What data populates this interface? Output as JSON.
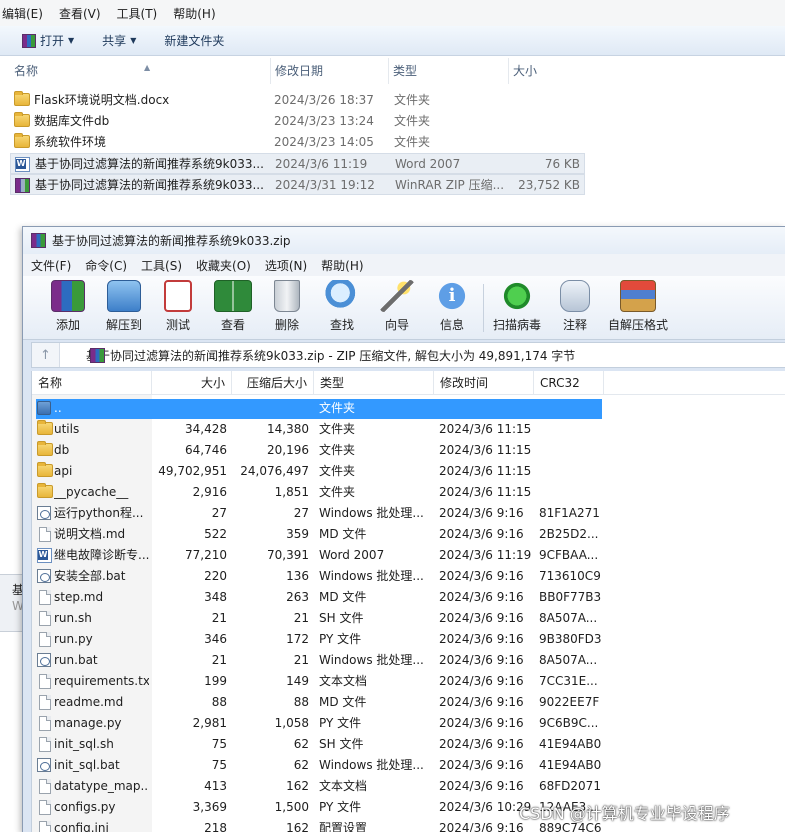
{
  "explorer": {
    "menu": [
      "编辑(E)",
      "查看(V)",
      "工具(T)",
      "帮助(H)"
    ],
    "toolbar": {
      "open_label": "打开",
      "share_label": "共享",
      "new_folder_label": "新建文件夹"
    },
    "columns": {
      "name": "名称",
      "date": "修改日期",
      "type": "类型",
      "size": "大小"
    },
    "files": [
      {
        "name": "Flask环境说明文档.docx",
        "date": "2024/3/26 18:37",
        "type": "文件夹",
        "size": "",
        "icon": "folder-icon"
      },
      {
        "name": "数据库文件db",
        "date": "2024/3/23 13:24",
        "type": "文件夹",
        "size": "",
        "icon": "folder-icon"
      },
      {
        "name": "系统软件环境",
        "date": "2024/3/23 14:05",
        "type": "文件夹",
        "size": "",
        "icon": "folder-icon"
      },
      {
        "name": "基于协同过滤算法的新闻推荐系统9k033...",
        "date": "2024/3/6 11:19",
        "type": "Word 2007",
        "size": "76 KB",
        "icon": "word-icon"
      },
      {
        "name": "基于协同过滤算法的新闻推荐系统9k033...",
        "date": "2024/3/31 19:12",
        "type": "WinRAR ZIP 压缩...",
        "size": "23,752 KB",
        "icon": "rar-icon"
      }
    ],
    "peek": {
      "line1": "基",
      "line2": "W"
    }
  },
  "rar": {
    "title": "基于协同过滤算法的新闻推荐系统9k033.zip",
    "menu": [
      "文件(F)",
      "命令(C)",
      "工具(S)",
      "收藏夹(O)",
      "选项(N)",
      "帮助(H)"
    ],
    "toolbar": [
      {
        "label": "添加",
        "icon": "add-archive-icon"
      },
      {
        "label": "解压到",
        "icon": "extract-to-icon"
      },
      {
        "label": "测试",
        "icon": "test-icon"
      },
      {
        "label": "查看",
        "icon": "view-icon"
      },
      {
        "label": "删除",
        "icon": "delete-icon"
      },
      {
        "label": "查找",
        "icon": "find-icon"
      },
      {
        "label": "向导",
        "icon": "wizard-icon"
      },
      {
        "label": "信息",
        "icon": "info-icon"
      },
      {
        "label": "扫描病毒",
        "icon": "virus-scan-icon"
      },
      {
        "label": "注释",
        "icon": "comment-icon"
      },
      {
        "label": "自解压格式",
        "icon": "sfx-icon"
      }
    ],
    "address": "基于协同过滤算法的新闻推荐系统9k033.zip - ZIP 压缩文件, 解包大小为 49,891,174 字节",
    "columns": {
      "name": "名称",
      "size": "大小",
      "packed": "压缩后大小",
      "type": "类型",
      "modified": "修改时间",
      "crc": "CRC32"
    },
    "rows": [
      {
        "name": "..",
        "size": "",
        "packed": "",
        "type": "文件夹",
        "modified": "",
        "crc": "",
        "icon": "up-icon",
        "selected": true
      },
      {
        "name": "utils",
        "size": "34,428",
        "packed": "14,380",
        "type": "文件夹",
        "modified": "2024/3/6 11:15",
        "crc": "",
        "icon": "folder-icon"
      },
      {
        "name": "db",
        "size": "64,746",
        "packed": "20,196",
        "type": "文件夹",
        "modified": "2024/3/6 11:15",
        "crc": "",
        "icon": "folder-icon"
      },
      {
        "name": "api",
        "size": "49,702,951",
        "packed": "24,076,497",
        "type": "文件夹",
        "modified": "2024/3/6 11:15",
        "crc": "",
        "icon": "folder-icon"
      },
      {
        "name": "__pycache__",
        "size": "2,916",
        "packed": "1,851",
        "type": "文件夹",
        "modified": "2024/3/6 11:15",
        "crc": "",
        "icon": "folder-icon"
      },
      {
        "name": "运行python程...",
        "size": "27",
        "packed": "27",
        "type": "Windows 批处理...",
        "modified": "2024/3/6 9:16",
        "crc": "81F1A271",
        "icon": "bat-icon"
      },
      {
        "name": "说明文档.md",
        "size": "522",
        "packed": "359",
        "type": "MD 文件",
        "modified": "2024/3/6 9:16",
        "crc": "2B25D2...",
        "icon": "file-icon"
      },
      {
        "name": "继电故障诊断专...",
        "size": "77,210",
        "packed": "70,391",
        "type": "Word 2007",
        "modified": "2024/3/6 11:19",
        "crc": "9CFBAA...",
        "icon": "word-icon"
      },
      {
        "name": "安装全部.bat",
        "size": "220",
        "packed": "136",
        "type": "Windows 批处理...",
        "modified": "2024/3/6 9:16",
        "crc": "713610C9",
        "icon": "bat-icon"
      },
      {
        "name": "step.md",
        "size": "348",
        "packed": "263",
        "type": "MD 文件",
        "modified": "2024/3/6 9:16",
        "crc": "BB0F77B3",
        "icon": "file-icon"
      },
      {
        "name": "run.sh",
        "size": "21",
        "packed": "21",
        "type": "SH 文件",
        "modified": "2024/3/6 9:16",
        "crc": "8A507A...",
        "icon": "file-icon"
      },
      {
        "name": "run.py",
        "size": "346",
        "packed": "172",
        "type": "PY 文件",
        "modified": "2024/3/6 9:16",
        "crc": "9B380FD3",
        "icon": "file-icon"
      },
      {
        "name": "run.bat",
        "size": "21",
        "packed": "21",
        "type": "Windows 批处理...",
        "modified": "2024/3/6 9:16",
        "crc": "8A507A...",
        "icon": "bat-icon"
      },
      {
        "name": "requirements.txt",
        "size": "199",
        "packed": "149",
        "type": "文本文档",
        "modified": "2024/3/6 9:16",
        "crc": "7CC31E...",
        "icon": "file-icon"
      },
      {
        "name": "readme.md",
        "size": "88",
        "packed": "88",
        "type": "MD 文件",
        "modified": "2024/3/6 9:16",
        "crc": "9022EE7F",
        "icon": "file-icon"
      },
      {
        "name": "manage.py",
        "size": "2,981",
        "packed": "1,058",
        "type": "PY 文件",
        "modified": "2024/3/6 9:16",
        "crc": "9C6B9C...",
        "icon": "file-icon"
      },
      {
        "name": "init_sql.sh",
        "size": "75",
        "packed": "62",
        "type": "SH 文件",
        "modified": "2024/3/6 9:16",
        "crc": "41E94AB0",
        "icon": "file-icon"
      },
      {
        "name": "init_sql.bat",
        "size": "75",
        "packed": "62",
        "type": "Windows 批处理...",
        "modified": "2024/3/6 9:16",
        "crc": "41E94AB0",
        "icon": "bat-icon"
      },
      {
        "name": "datatype_map....",
        "size": "413",
        "packed": "162",
        "type": "文本文档",
        "modified": "2024/3/6 9:16",
        "crc": "68FD2071",
        "icon": "file-icon"
      },
      {
        "name": "configs.py",
        "size": "3,369",
        "packed": "1,500",
        "type": "PY 文件",
        "modified": "2024/3/6 10:29",
        "crc": "12AAE3...",
        "icon": "file-icon"
      },
      {
        "name": "config.ini",
        "size": "218",
        "packed": "162",
        "type": "配置设置",
        "modified": "2024/3/6 9:16",
        "crc": "889C74C6",
        "icon": "file-icon"
      }
    ]
  },
  "watermark": "CSDN @计算机专业毕设程序",
  "colors": {
    "selection": "#3399ff",
    "toolbar_text": "#1e395b"
  }
}
